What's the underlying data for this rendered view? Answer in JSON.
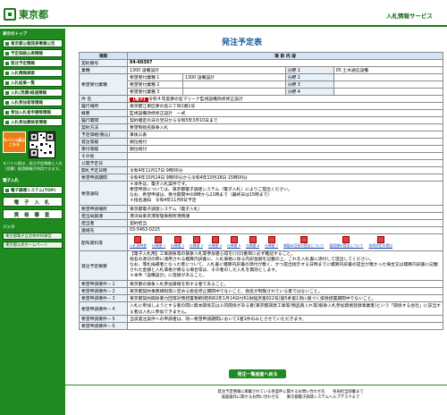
{
  "header": {
    "logo_text": "東京都",
    "service_title": "入札情報サービス"
  },
  "sidebar": {
    "section1": "表示のトップ",
    "items": [
      {
        "label": "東京都公報発表事業公告"
      },
      {
        "label": "予定価格公表情報"
      },
      {
        "label": "発注予定情報"
      },
      {
        "label": "入札情報検索"
      },
      {
        "label": "入札結果一覧"
      },
      {
        "label": "入札(見積)経過情報"
      },
      {
        "label": "入札参加者等情報"
      },
      {
        "label": "参加入札者申請等情報"
      },
      {
        "label": "入札参加資格者情報"
      }
    ],
    "mobile_label": "モバイル版はこちら",
    "mobile_note": "モバイル版は、発注予定情報と入札（見積）経過情報が利用できます。",
    "section2": "電子入札",
    "system_link": "電子調達システム(TOP)",
    "big1": "電 子 入 札",
    "big2": "資 格 審 査",
    "section3": "リンク",
    "link1": "東京都電子自治体共同運営",
    "link2": "東京都公式ホームページ"
  },
  "page": {
    "title": "発注予定表"
  },
  "table": {
    "col_item": "項目",
    "col_content": "項 目 内 容",
    "contract_no_label": "契約番号",
    "contract_no": "04-00397",
    "business_label": "業種",
    "business_value": "1300 設備設計",
    "category_label": "分野 1",
    "category_value": "05 土木通信設備",
    "hope_label": "希望受付業種",
    "hope1": "希望受付業種 1",
    "hope1_value": "1300 設備設計",
    "hope2": "希望受付業種 2",
    "hope3": "希望受付業種 3",
    "field2": "分野 2",
    "field3": "分野 3",
    "field4": "分野 4",
    "name_label": "件 名",
    "name_tag": "【電子】",
    "name_value": "令和４年度夢の島マリーナ監視設備改修修正設計",
    "place_label": "履行場所",
    "place_value": "東京都江東区夢の島三丁目2番1号",
    "summary_label": "概要",
    "summary_value": "監視設備改修修正設計　一式",
    "period_label": "履行期間",
    "period_value": "契約確定の日の翌日から令和5年3月10日まで",
    "method_label": "契約方法",
    "method_value": "希望制指名競争入札",
    "price_label": "予定価格(税込)",
    "price_value": "事後公表",
    "form_label": "発注等級",
    "form_value": "順位格付",
    "grade_label": "受付等級",
    "grade_value": "順位格付",
    "other_label": "その他",
    "announce_label": "公開予定日",
    "open_label": "開札予定日時",
    "open_value": "令和4年11月17日 9時00分",
    "apply_label": "希望申請期間",
    "apply_value": "令和4年10月24日 9時00分から令和4年10月28日 15時00分",
    "notes_label": "希望通知",
    "notes_line1": "＊本件は、電子入札案件です。",
    "notes_line2": "希望申請については、東京都電子調達システム（電子入札）によりご提出ください。",
    "notes_line3": "なお、希望申請は、受付期間中の8時から21時まで（最終日は15時まで）",
    "notes_line4": "＊指名通知　令和4年11月8日予定",
    "apply_place_label": "希望申請場所",
    "apply_place_value": "東京都電子調達システム（電子入札）",
    "dept_label": "担当局部課",
    "dept_value": "港湾局東京港管理事務所港務課",
    "person_label": "担当者",
    "person_value": "契約担当",
    "contact_label": "連絡先",
    "contact_value": "03-5463-0215",
    "attach_label": "配布資料等",
    "attachments": [
      "入札説明書",
      "仕様書 1",
      "仕様書 2",
      "仕様書 3",
      "仕様書 4",
      "仕様書 5",
      "仕様書 6",
      "仕様書 7",
      "質疑の回答の提出について",
      "図面類の提出について",
      "技術評定の提出"
    ],
    "remarks_label": "発注予定概要",
    "remarks_line1": "【電子入札用】工事請負等の競争入札等参加者心得を(ｲ)(ﾛ)番目に必ず確認すること。",
    "remarks_line2": "指名の適切の際に適用される積算内訳書に、入札価格に係る内訳金額を記載の上、これを入札書に添付して提出してください。",
    "remarks_line3": "なお、落札候補者となった者について、入札書に積算内訳書の添付が無く、かつ提出指示する日時までに積算内訳書の提出が無かった場合又は積算内訳書に記載された金額と入札価格が異なる場合等は、その者のした入札を無効とします。",
    "remarks_line4": "＊本件「設備設計」に登録があること。",
    "cond1_label": "希望申請要件－１",
    "cond1_value": "東京都の競争入札参加資格を有する者であること。",
    "cond2_label": "希望申請要件－２",
    "cond2_value": "東京都契約事務規則等に定める指名停止期間中でないこと、指名が制限されている者ではないこと。",
    "cond3_label": "希望申請要件－３",
    "cond3_value": "東京都契約関係暴力団等対策措置要綱(昭和62年1月14日付61財経庶第922号)第5条第1項に基づく排除措置期間中でないこと。",
    "cond4_label": "希望申請要件－４",
    "cond4_value": "入札に参加しようとする者の間に資本関係又は人的関係がある者(東京都調達工事等(物品買入れ等)競争入札参加資格登録事業者)という「関係する会社」に該当する者は入札に参加できません。",
    "cond5_label": "希望申請要件－５",
    "cond5_value": "当該発注案件への申請者は、同一希望申請期間において1者1件のみとさせていただきます。",
    "cond6_label": "希望申請要件－６"
  },
  "back_button": "発注一覧画面へ戻る",
  "footer": {
    "line1": "発注予定情報に掲載されている各案件に関するお問い合わせ先　　各局担当部署まで",
    "line2": "画面操作に関するお問い合わせ先　　東京都電子調達システムヘルプデスクまで"
  }
}
